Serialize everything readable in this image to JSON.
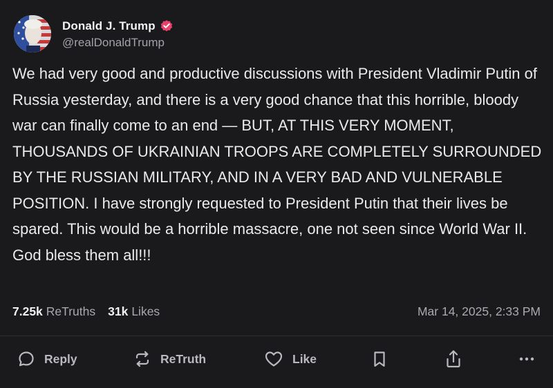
{
  "author": {
    "display_name": "Donald J. Trump",
    "handle": "@realDonaldTrump",
    "verified_icon": "verified-badge-icon",
    "verified_color": "#e8426b"
  },
  "post": {
    "text": "We had very good and productive discussions with President Vladimir Putin of Russia yesterday, and there is a very good chance that this horrible, bloody war can finally come to an end — BUT, AT THIS VERY MOMENT, THOUSANDS OF UKRAINIAN TROOPS ARE COMPLETELY SURROUNDED BY THE RUSSIAN MILITARY, AND IN A VERY BAD AND VULNERABLE POSITION. I have strongly requested to President Putin that their lives be spared. This would be a horrible massacre, one not seen since World War II. God bless them all!!!"
  },
  "stats": {
    "retruths_count": "7.25k",
    "retruths_label": "ReTruths",
    "likes_count": "31k",
    "likes_label": "Likes",
    "timestamp": "Mar 14, 2025, 2:33 PM"
  },
  "actions": {
    "reply_label": "Reply",
    "retruth_label": "ReTruth",
    "like_label": "Like",
    "icons": [
      "reply-icon",
      "retruth-icon",
      "like-icon",
      "bookmark-icon",
      "share-icon",
      "more-icon"
    ]
  },
  "colors": {
    "background": "#1a1a1d",
    "text": "#eaeaea",
    "muted": "#a9a9ae",
    "accent": "#e8426b"
  }
}
